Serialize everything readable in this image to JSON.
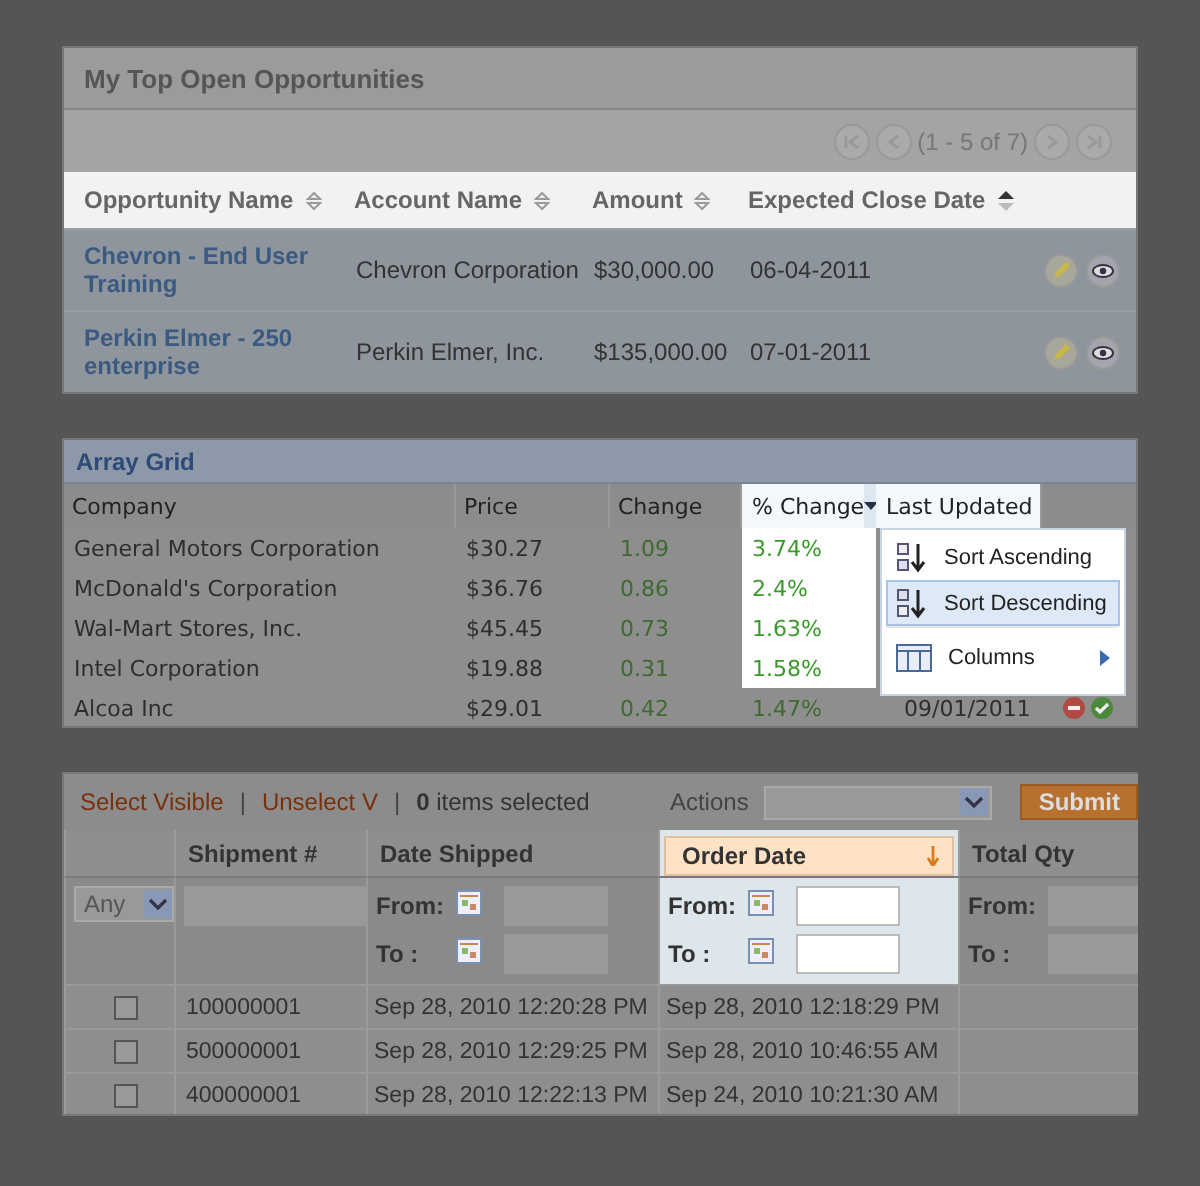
{
  "opportunities": {
    "title": "My Top Open Opportunities",
    "pager": {
      "status": "(1 - 5 of 7)"
    },
    "columns": [
      {
        "label": "Opportunity Name",
        "sorted_ascending": false
      },
      {
        "label": "Account Name",
        "sorted_ascending": false
      },
      {
        "label": "Amount",
        "sorted_ascending": false
      },
      {
        "label": "Expected Close Date",
        "sorted_ascending": true
      }
    ],
    "rows": [
      {
        "name": "Chevron - End User Training",
        "account": "Chevron Corporation",
        "amount": "$30,000.00",
        "close_date": "06-04-2011"
      },
      {
        "name": "Perkin Elmer - 250 enterprise",
        "account": "Perkin Elmer, Inc.",
        "amount": "$135,000.00",
        "close_date": "07-01-2011"
      }
    ]
  },
  "array_grid": {
    "title": "Array Grid",
    "columns": [
      {
        "label": "Company",
        "highlighted": false,
        "menu_open": false
      },
      {
        "label": "Price",
        "highlighted": false,
        "menu_open": false
      },
      {
        "label": "Change",
        "highlighted": false,
        "menu_open": false
      },
      {
        "label": "% Change",
        "highlighted": true,
        "menu_open": true
      },
      {
        "label": "Last Updated",
        "highlighted": true,
        "menu_open": false
      }
    ],
    "rows": [
      {
        "highlighted": true,
        "company": "General Motors Corporation",
        "price": "$30.27",
        "change": "1.09",
        "pct_change": "3.74%"
      },
      {
        "highlighted": true,
        "company": "McDonald's Corporation",
        "price": "$36.76",
        "change": "0.86",
        "pct_change": "2.4%"
      },
      {
        "highlighted": true,
        "company": "Wal-Mart Stores, Inc.",
        "price": "$45.45",
        "change": "0.73",
        "pct_change": "1.63%"
      },
      {
        "highlighted": true,
        "company": "Intel Corporation",
        "price": "$19.88",
        "change": "0.31",
        "pct_change": "1.58%"
      },
      {
        "highlighted": false,
        "company": "Alcoa Inc",
        "price": "$29.01",
        "change": "0.42",
        "pct_change": "1.47%",
        "last_updated": "09/01/2011"
      }
    ],
    "menu": [
      {
        "kind": "sort-ascending",
        "label": "Sort Ascending",
        "selected": false
      },
      {
        "kind": "sort-descending",
        "label": "Sort Descending",
        "selected": true
      },
      {
        "kind": "columns",
        "label": "Columns",
        "selected": false
      }
    ]
  },
  "shipments": {
    "toolbar": {
      "links": [
        "Select Visible",
        "Unselect V"
      ],
      "separators": [
        "|",
        "|"
      ],
      "count": "0 items selected",
      "actions_label": "Actions",
      "submit": "Submit"
    },
    "columns": [
      {
        "highlighted": false,
        "filter": {
          "kind": "select",
          "value": "Any"
        }
      },
      {
        "label": "Shipment #",
        "highlighted": false,
        "sorted_descending": false,
        "filter": {
          "kind": "text"
        }
      },
      {
        "label": "Date Shipped",
        "highlighted": false,
        "sorted_descending": false,
        "filter": {
          "kind": "date-range",
          "from": "From:",
          "to": "To :"
        }
      },
      {
        "label": "Order Date",
        "highlighted": true,
        "sorted_descending": true,
        "filter": {
          "kind": "date-range",
          "from": "From:",
          "to": "To :"
        }
      },
      {
        "label": "Total Qty",
        "highlighted": false,
        "sorted_descending": false,
        "filter": {
          "kind": "range",
          "from": "From:",
          "to": "To :"
        }
      }
    ],
    "rows": [
      {
        "checked": false,
        "shipment": "100000001",
        "date_shipped": "Sep 28, 2010 12:20:28 PM",
        "order_date": "Sep 28, 2010 12:18:29 PM"
      },
      {
        "checked": false,
        "shipment": "500000001",
        "date_shipped": "Sep 28, 2010 12:29:25 PM",
        "order_date": "Sep 28, 2010 10:46:55 AM"
      },
      {
        "checked": false,
        "shipment": "400000001",
        "date_shipped": "Sep 28, 2010 12:22:13 PM",
        "order_date": "Sep 24, 2010 10:21:30 AM"
      }
    ]
  }
}
